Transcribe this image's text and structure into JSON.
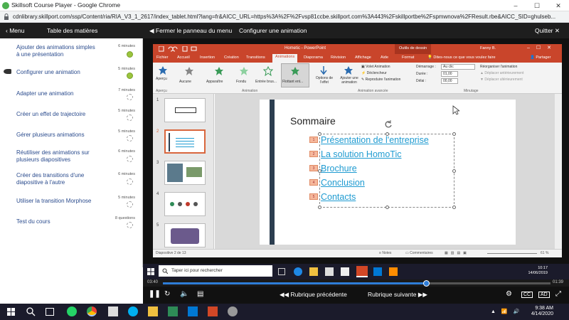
{
  "browser": {
    "title": "Skillsoft Course Player - Google Chrome",
    "url": "cdnlibrary.skillport.com/ssp/Content/ria/RIA_V3_1_2617/index_tablet.html?lang=fr&AICC_URL=https%3A%2F%2Fvsp81ccbe.skillport.com%3A443%2Fskillportbe%2Fspmwnova%2FResult.rbe&AICC_SID=ghulseb..."
  },
  "topbar": {
    "menu": "Menu",
    "toc": "Table des matières",
    "close_panel": "Fermer le panneau du menu",
    "current": "Configurer une animation",
    "quit": "Quitter"
  },
  "toc": [
    {
      "label": "Ajouter des animations simples à une présentation",
      "duration": "6 minutes",
      "status": "done"
    },
    {
      "label": "Configurer une animation",
      "duration": "5 minutes",
      "status": "done"
    },
    {
      "label": "Adapter une animation",
      "duration": "7 minutes",
      "status": "todo"
    },
    {
      "label": "Créer un effet de trajectoire",
      "duration": "5 minutes",
      "status": "todo"
    },
    {
      "label": "Gérer plusieurs animations",
      "duration": "5 minutes",
      "status": "todo"
    },
    {
      "label": "Réutiliser des animations sur plusieurs diapositives",
      "duration": "6 minutes",
      "status": "todo"
    },
    {
      "label": "Créer des transitions d'une diapositive à l'autre",
      "duration": "6 minutes",
      "status": "todo"
    },
    {
      "label": "Utiliser la transition Morphose",
      "duration": "5 minutes",
      "status": "todo"
    },
    {
      "label": "Test du cours",
      "duration": "8 questions",
      "status": "todo"
    }
  ],
  "ppt": {
    "title": "Hometic - PowerPoint",
    "tools_tab": "Outils de dessin",
    "user": "Fanny B.",
    "tabs": [
      "Fichier",
      "Accueil",
      "Insertion",
      "Création",
      "Transitions",
      "Animations",
      "Diaporama",
      "Révision",
      "Affichage",
      "Aide",
      "Format"
    ],
    "tell_me": "Dites-nous ce que vous voulez faire",
    "share": "Partager",
    "ribbon": {
      "preview": "Aperçu",
      "effects": [
        "Aucune",
        "Apparaître",
        "Fondu",
        "Entrée brus...",
        "Flottant ent..."
      ],
      "effect_options": "Options de l'effet",
      "add_animation": "Ajouter une animation",
      "animation_pane": "Volet Animation",
      "trigger": "Déclencheur",
      "painter": "Reproduire l'animation",
      "start_label": "Démarrage :",
      "start_value": "Au clic",
      "duration_label": "Durée :",
      "duration_value": "01,00",
      "delay_label": "Délai :",
      "delay_value": "00,00",
      "reorder": "Réorganiser l'animation",
      "move_earlier": "Déplacer antérieurement",
      "move_later": "Déplacer ultérieurement",
      "group_preview": "Aperçu",
      "group_animation": "Animation",
      "group_advanced": "Animation avancée",
      "group_timing": "Minutage"
    },
    "thumb_numbers": [
      "1",
      "2",
      "3",
      "4",
      "5"
    ],
    "slide_title": "Sommaire",
    "bullets": [
      "Présentation de l'entreprise",
      "La solution HomoTic",
      "Brochure",
      "Conclusion",
      "Contacts"
    ],
    "bullet_numbers": [
      "1",
      "2",
      "3",
      "4",
      "5"
    ],
    "status_slide": "Diapositive 2 de 13",
    "status_notes": "Notes",
    "status_comments": "Commentaires",
    "zoom": "61 %"
  },
  "vtaskbar": {
    "search_placeholder": "Taper ici pour rechercher",
    "time": "10:17",
    "date": "14/06/2019"
  },
  "player": {
    "current_time": "03:40",
    "total_time": "01:39",
    "progress": 0.68,
    "prev": "Rubrique précédente",
    "next": "Rubrique suivante"
  },
  "taskbar": {
    "time": "9:38 AM",
    "date": "4/14/2020"
  },
  "colors": {
    "ppt_accent": "#c9452b",
    "link": "#1f9bd1",
    "progress": "#2e7dd7",
    "done": "#9bc53d"
  }
}
